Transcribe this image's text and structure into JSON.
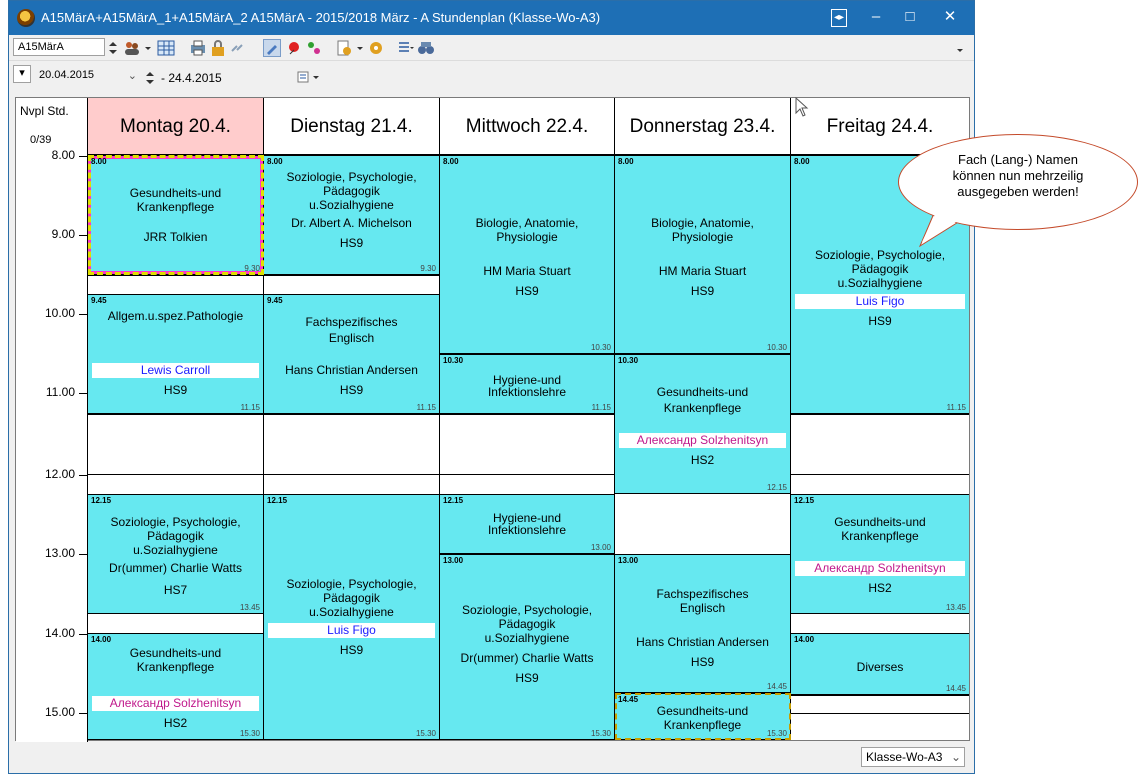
{
  "window": {
    "title": "A15MärA+A15MärA_1+A15MärA_2 A15MärA - 2015/2018 März - A  Stundenplan  (Klasse-Wo-A3)",
    "minimize": "–",
    "maximize": "□",
    "close": "✕"
  },
  "toolbar": {
    "class_select": "A15MärA",
    "date_from": "20.04.2015",
    "date_to": "- 24.4.2015",
    "arrow_left": "▾"
  },
  "timetable": {
    "nvpl_label": "Nvpl Std.",
    "nvpl_count": "0/39",
    "days": [
      "Montag 20.4.",
      "Dienstag 21.4.",
      "Mittwoch 22.4.",
      "Donnerstag 23.4.",
      "Freitag 24.4."
    ],
    "times": [
      "8.00",
      "9.00",
      "10.00",
      "11.00",
      "12.00",
      "13.00",
      "14.00",
      "15.00"
    ],
    "lessons": {
      "mo1": {
        "start": "8.00",
        "end": "9.30",
        "l1": "Gesundheits-und",
        "l2": "Krankenpflege",
        "teacher": "JRR Tolkien"
      },
      "mo2": {
        "start": "9.45",
        "end": "11.15",
        "l1": "Allgem.u.spez.Pathologie",
        "teacher": "Lewis Carroll",
        "room": "HS9"
      },
      "mo3": {
        "start": "12.15",
        "end": "13.45",
        "l1": "Soziologie, Psychologie,",
        "l2": "Pädagogik",
        "l3": "u.Sozialhygiene",
        "teacher": "Dr(ummer) Charlie Watts",
        "room": "HS7"
      },
      "mo4": {
        "start": "14.00",
        "end": "15.30",
        "l1": "Gesundheits-und",
        "l2": "Krankenpflege",
        "teacher": "Александр Solzhenitsyn",
        "room": "HS2"
      },
      "di1": {
        "start": "8.00",
        "end": "9.30",
        "l1": "Soziologie, Psychologie,",
        "l2": "Pädagogik",
        "l3": "u.Sozialhygiene",
        "teacher": "Dr. Albert A. Michelson",
        "room": "HS9"
      },
      "di2": {
        "start": "9.45",
        "end": "11.15",
        "l1": "Fachspezifisches",
        "l2": "Englisch",
        "teacher": "Hans Christian Andersen",
        "room": "HS9"
      },
      "di3": {
        "start": "12.15",
        "end": "15.30",
        "l1": "Soziologie, Psychologie,",
        "l2": "Pädagogik",
        "l3": "u.Sozialhygiene",
        "teacher": "Luis Figo",
        "room": "HS9"
      },
      "mi1": {
        "start": "8.00",
        "end": "10.30",
        "l1": "Biologie, Anatomie,",
        "l2": "Physiologie",
        "teacher": "HM Maria Stuart",
        "room": "HS9"
      },
      "mi2": {
        "start": "10.30",
        "end": "11.15",
        "l1": "Hygiene-und",
        "l2": "Infektionslehre"
      },
      "mi3": {
        "start": "12.15",
        "end": "13.00",
        "l1": "Hygiene-und",
        "l2": "Infektionslehre"
      },
      "mi4": {
        "start": "13.00",
        "end": "15.30",
        "l1": "Soziologie, Psychologie,",
        "l2": "Pädagogik",
        "l3": "u.Sozialhygiene",
        "teacher": "Dr(ummer) Charlie Watts",
        "room": "HS9"
      },
      "do1": {
        "start": "8.00",
        "end": "10.30",
        "l1": "Biologie, Anatomie,",
        "l2": "Physiologie",
        "teacher": "HM Maria Stuart",
        "room": "HS9"
      },
      "do2": {
        "start": "10.30",
        "end": "12.15",
        "l1": "Gesundheits-und",
        "l2": "Krankenpflege",
        "teacher": "Александр Solzhenitsyn",
        "room": "HS2"
      },
      "do3": {
        "start": "13.00",
        "end": "14.45",
        "l1": "Fachspezifisches",
        "l2": "Englisch",
        "teacher": "Hans Christian Andersen",
        "room": "HS9"
      },
      "do4": {
        "start": "14.45",
        "end": "15.30",
        "l1": "Gesundheits-und",
        "l2": "Krankenpflege"
      },
      "fr1": {
        "start": "8.00",
        "end": "11.15",
        "l1": "Soziologie, Psychologie,",
        "l2": "Pädagogik",
        "l3": "u.Sozialhygiene",
        "teacher": "Luis Figo",
        "room": "HS9"
      },
      "fr2": {
        "start": "12.15",
        "end": "13.45",
        "l1": "Gesundheits-und",
        "l2": "Krankenpflege",
        "teacher": "Александр Solzhenitsyn",
        "room": "HS2"
      },
      "fr3": {
        "start": "14.00",
        "end": "14.45",
        "l1": "Diverses"
      }
    }
  },
  "callout": {
    "l1": "Fach (Lang-) Namen",
    "l2": "können nun mehrzeilig",
    "l3": "ausgegeben werden!"
  },
  "statusbar": {
    "view_select": "Klasse-Wo-A3"
  }
}
